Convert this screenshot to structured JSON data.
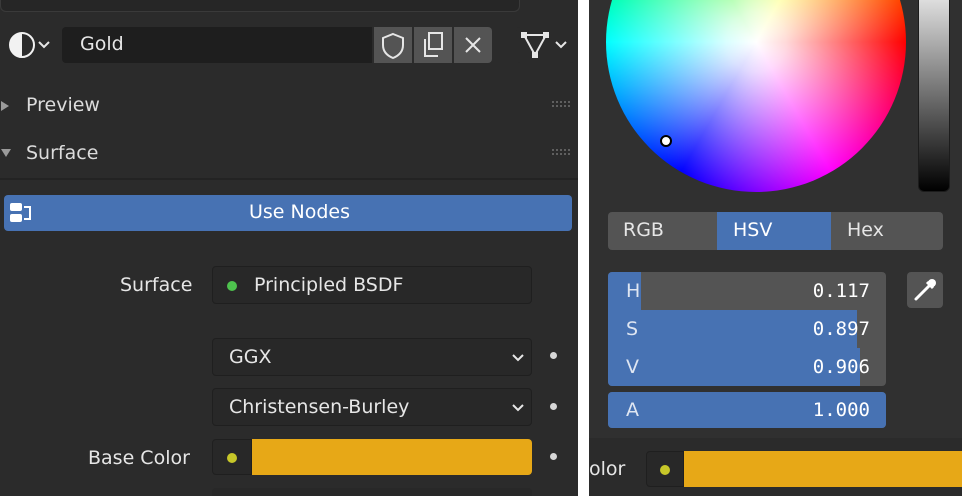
{
  "material": {
    "name": "Gold"
  },
  "panels": {
    "preview_label": "Preview",
    "surface_label": "Surface"
  },
  "use_nodes_label": "Use Nodes",
  "surface": {
    "label": "Surface",
    "shader": "Principled BSDF"
  },
  "distribution": "GGX",
  "subsurface_method": "Christensen-Burley",
  "base_color": {
    "label": "Base Color",
    "color": "#e7a817"
  },
  "picker": {
    "tabs": [
      "RGB",
      "HSV",
      "Hex"
    ],
    "active_tab": "HSV",
    "values": [
      {
        "label": "H",
        "value": "0.117",
        "fraction": 0.117
      },
      {
        "label": "S",
        "value": "0.897",
        "fraction": 0.897
      },
      {
        "label": "V",
        "value": "0.906",
        "fraction": 0.906
      },
      {
        "label": "A",
        "value": "1.000",
        "fraction": 1.0
      }
    ],
    "partial_label": "olor"
  },
  "colors": {
    "accent": "#4772b3",
    "gold": "#e7a817",
    "socket_green": "#4ec24e",
    "socket_yellow": "#c7c729"
  },
  "icons": [
    "material-sphere-icon",
    "shield-icon",
    "duplicate-icon",
    "close-icon",
    "node-tree-icon",
    "eyedropper-icon"
  ]
}
